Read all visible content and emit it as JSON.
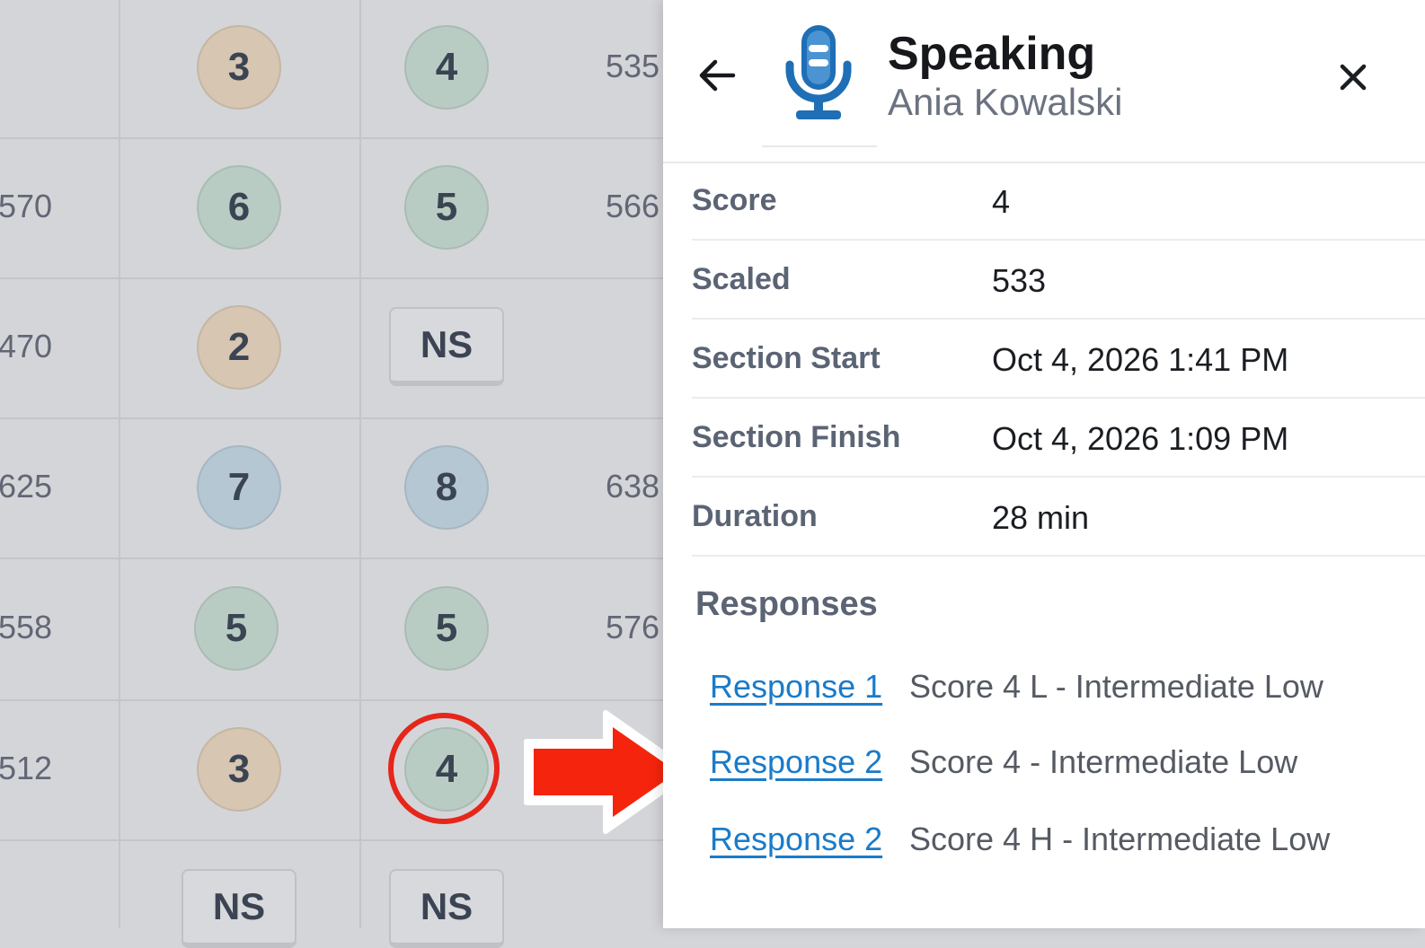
{
  "grid": {
    "left_numbers": [
      "570",
      "470",
      "625",
      "558",
      "512"
    ],
    "col1": [
      {
        "text": "3",
        "color": "#d6c6b2"
      },
      {
        "text": "6",
        "color": "#b8ccc3"
      },
      {
        "text": "2",
        "color": "#d6c6b2"
      },
      {
        "text": "7",
        "color": "#b5c7d3"
      },
      {
        "text": "5",
        "color": "#b8ccc3"
      },
      {
        "text": "3",
        "color": "#d6c6b2"
      },
      {
        "text": "NS"
      }
    ],
    "col2": [
      {
        "text": "4",
        "color": "#b8ccc3"
      },
      {
        "text": "5",
        "color": "#b8ccc3"
      },
      {
        "text": "NS"
      },
      {
        "text": "8",
        "color": "#b5c7d3"
      },
      {
        "text": "5",
        "color": "#b8ccc3"
      },
      {
        "text": "4",
        "color": "#b8ccc3"
      },
      {
        "text": "NS"
      }
    ],
    "right_numbers": [
      "535",
      "566",
      "638",
      "576"
    ]
  },
  "panel": {
    "title": "Speaking",
    "subtitle": "Ania Kowalski",
    "icons": {
      "back": "arrow-left-icon",
      "section": "microphone-icon",
      "close": "close-icon"
    },
    "details": [
      {
        "label": "Score",
        "value": "4"
      },
      {
        "label": "Scaled",
        "value": "533"
      },
      {
        "label": "Section Start",
        "value": "Oct 4, 2026 1:41 PM"
      },
      {
        "label": "Section Finish",
        "value": "Oct 4, 2026 1:09 PM"
      },
      {
        "label": "Duration",
        "value": "28 min"
      }
    ],
    "responses_heading": "Responses",
    "responses": [
      {
        "link": "Response 1",
        "desc": "Score 4 L - Intermediate Low"
      },
      {
        "link": "Response 2",
        "desc": "Score 4 - Intermediate Low"
      },
      {
        "link": "Response 2",
        "desc": "Score 4 H - Intermediate Low"
      }
    ]
  },
  "colors": {
    "link": "#1a7bc9",
    "annotation_red": "#e6261a",
    "mic_blue": "#1e6fb5"
  }
}
